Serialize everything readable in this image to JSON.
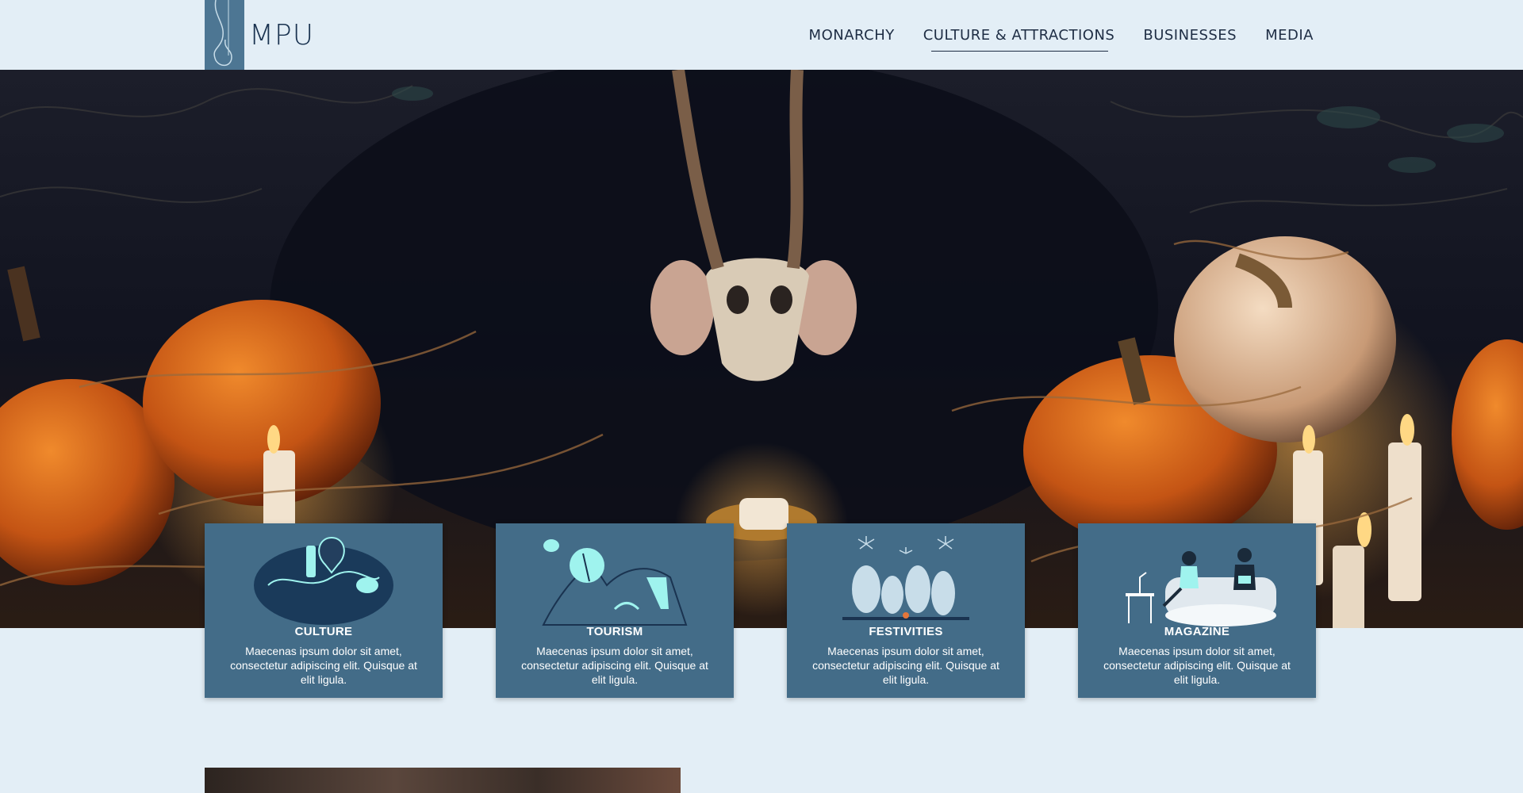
{
  "brand": {
    "name": "MPU"
  },
  "nav": [
    {
      "label": "MONARCHY",
      "active": false
    },
    {
      "label": "CULTURE & ATTRACTIONS",
      "active": true
    },
    {
      "label": "BUSINESSES",
      "active": false
    },
    {
      "label": "MEDIA",
      "active": false
    }
  ],
  "cards": [
    {
      "title": "CULTURE",
      "text": "Maecenas ipsum dolor sit amet, consectetur adipiscing elit. Quisque at elit ligula.",
      "icon": "map-illustration"
    },
    {
      "title": "TOURISM",
      "text": "Maecenas ipsum dolor sit amet, consectetur adipiscing elit. Quisque at elit ligula.",
      "icon": "mountain-illustration"
    },
    {
      "title": "FESTIVITIES",
      "text": "Maecenas ipsum dolor sit amet, consectetur adipiscing elit. Quisque at elit ligula.",
      "icon": "fireworks-illustration"
    },
    {
      "title": "MAGAZINE",
      "text": "Maecenas ipsum dolor sit amet, consectetur adipiscing elit. Quisque at elit ligula.",
      "icon": "reading-couch-illustration"
    }
  ],
  "colors": {
    "background": "#e3eef6",
    "card": "#436c88",
    "accent": "#9ff3ee",
    "nav_text": "#1e2d44"
  }
}
